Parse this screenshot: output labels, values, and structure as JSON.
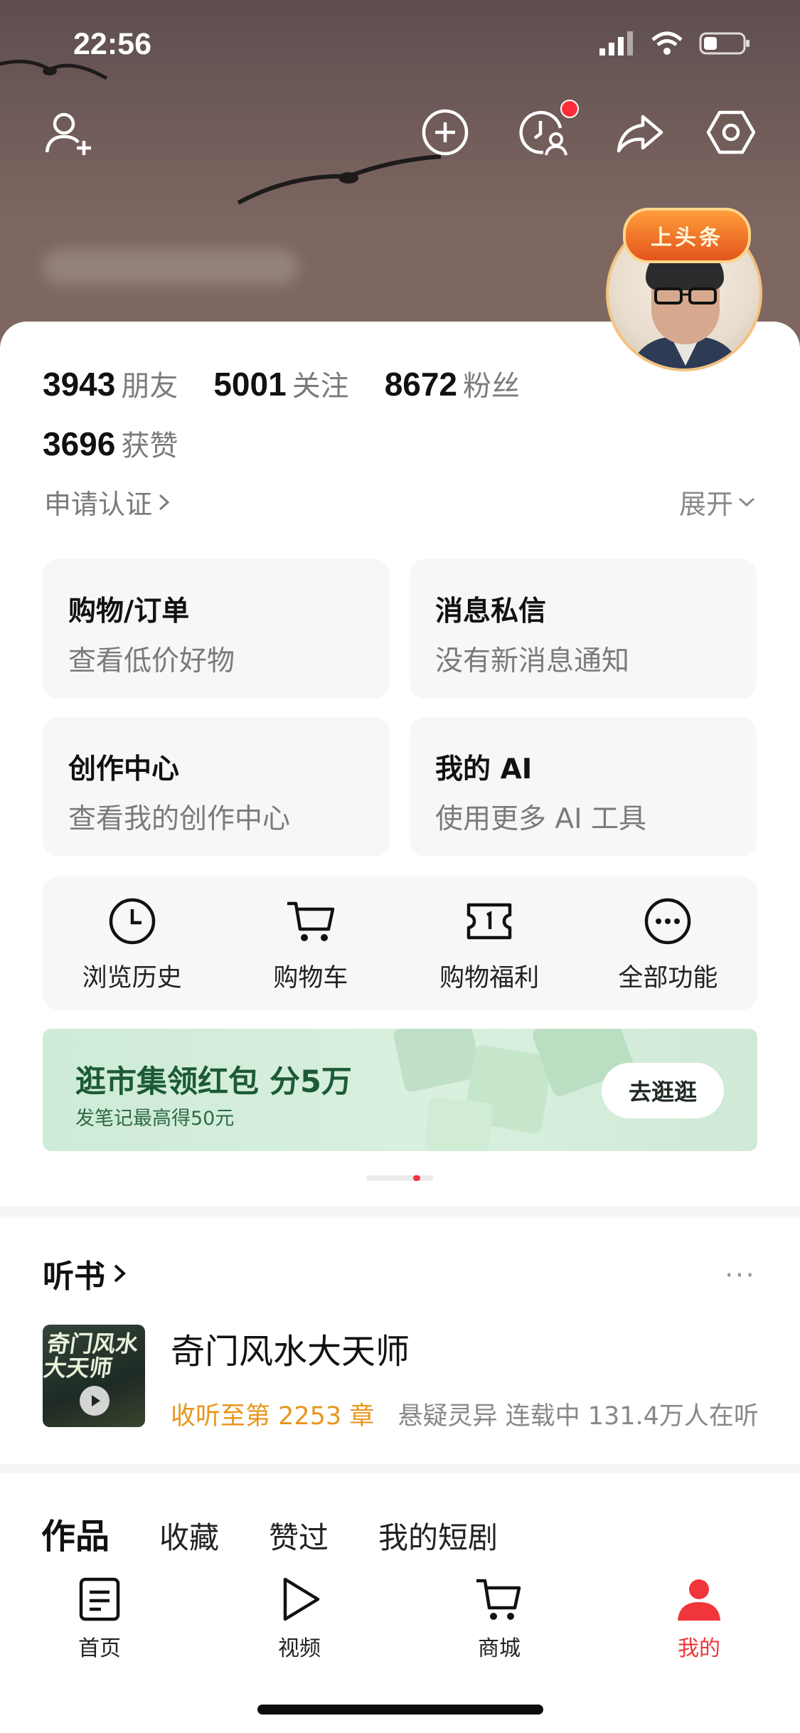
{
  "status": {
    "time": "22:56"
  },
  "header": {
    "icons": [
      "add-friend-icon",
      "add-icon",
      "visitor-icon",
      "share-icon",
      "settings-icon"
    ],
    "badge_text": "上头条"
  },
  "stats": [
    {
      "num": "3943",
      "label": "朋友"
    },
    {
      "num": "5001",
      "label": "关注"
    },
    {
      "num": "8672",
      "label": "粉丝"
    }
  ],
  "likes": {
    "num": "3696",
    "label": "获赞"
  },
  "verify_label": "申请认证",
  "expand_label": "展开",
  "tiles": [
    {
      "title": "购物/订单",
      "subtitle": "查看低价好物"
    },
    {
      "title": "消息私信",
      "subtitle": "没有新消息通知"
    },
    {
      "title": "创作中心",
      "subtitle": "查看我的创作中心"
    },
    {
      "title": "我的 AI",
      "subtitle": "使用更多 AI 工具"
    }
  ],
  "tools": [
    {
      "label": "浏览历史",
      "icon": "clock-icon"
    },
    {
      "label": "购物车",
      "icon": "cart-icon"
    },
    {
      "label": "购物福利",
      "icon": "coupon-icon"
    },
    {
      "label": "全部功能",
      "icon": "more-icon"
    }
  ],
  "banner": {
    "title": "逛市集领红包 分5万",
    "subtitle": "发笔记最高得50元",
    "button": "去逛逛",
    "color": "#cdebd7"
  },
  "listen": {
    "title": "听书",
    "more": "···",
    "cover_text_line1": "奇门风水",
    "cover_text_line2": "大天师",
    "book_title": "奇门风水大天师",
    "progress": "收听至第 2253 章",
    "meta": "悬疑灵异  连载中 131.4万人在听"
  },
  "tabs": [
    "作品",
    "收藏",
    "赞过",
    "我的短剧"
  ],
  "bottom_nav": [
    {
      "label": "首页",
      "icon": "home-doc-icon"
    },
    {
      "label": "视频",
      "icon": "video-play-icon"
    },
    {
      "label": "商城",
      "icon": "mall-cart-icon"
    },
    {
      "label": "我的",
      "icon": "profile-icon",
      "active": true
    }
  ],
  "colors": {
    "accent": "#f0353b",
    "orange": "#e8961c"
  }
}
